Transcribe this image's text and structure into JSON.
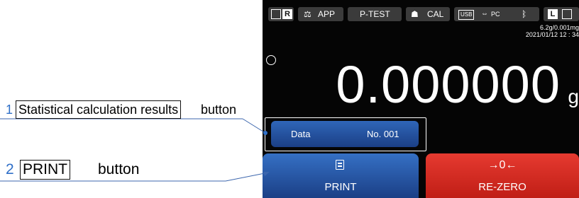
{
  "annotations": {
    "callout1": {
      "number": "1",
      "label": "Statistical calculation results",
      "suffix": "button"
    },
    "callout2": {
      "number": "2",
      "label": "PRINT",
      "suffix": "button"
    },
    "number_color": "#2f6fc8"
  },
  "status_bar": {
    "r_label": "R",
    "app_label": "APP",
    "ptest_label": "P-TEST",
    "cal_label": "CAL",
    "usb_label": "USB",
    "pc_label": "PC",
    "l_label": "L",
    "icons": [
      "square-icon",
      "r-icon",
      "balance-icon",
      "weight-icon",
      "usb-icon",
      "pc-icon",
      "bluetooth-icon",
      "l-icon",
      "square-icon"
    ]
  },
  "spec": "6.2g/0.001mg",
  "datetime": "2021/01/12  12 : 34",
  "reading": {
    "value": "0.000000",
    "unit": "g"
  },
  "data_button": {
    "label": "Data",
    "number": "No. 001"
  },
  "print_button": {
    "label": "PRINT"
  },
  "rezero_button": {
    "glyph": "→0←",
    "label": "RE-ZERO"
  },
  "colors": {
    "blue_button": "#1e4fa0",
    "red_button": "#d42b22",
    "screen": "#050505"
  }
}
